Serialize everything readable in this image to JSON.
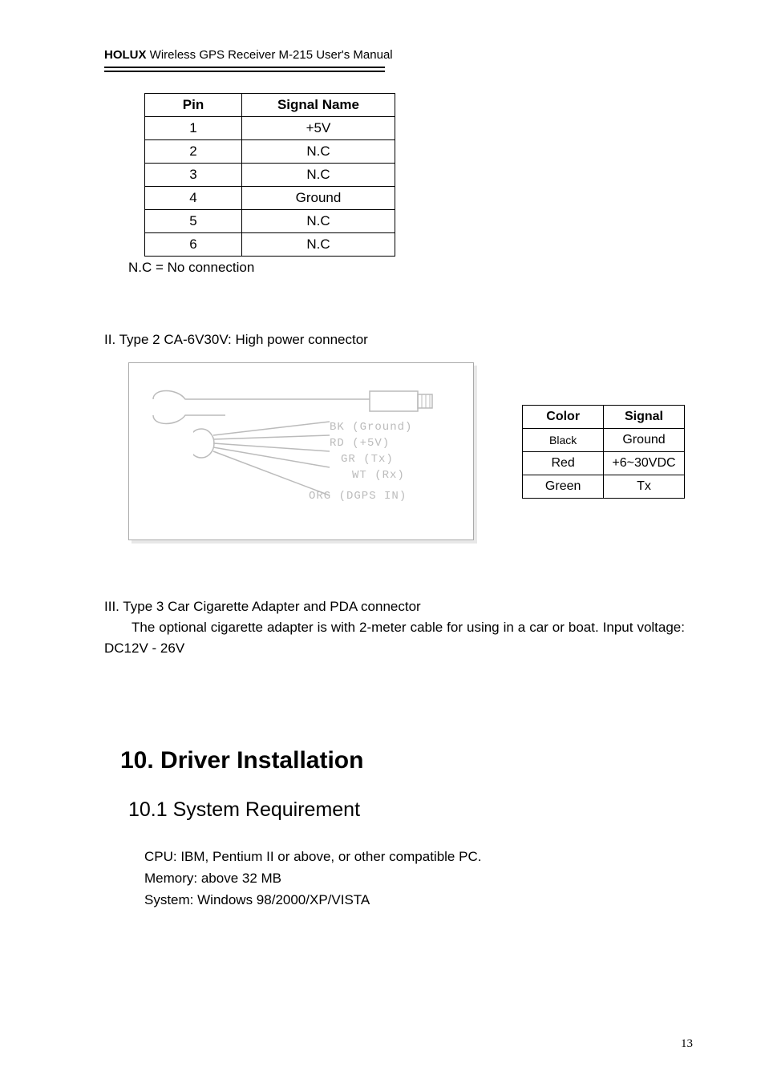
{
  "header": {
    "brand": "HOLUX",
    "rest": " Wireless GPS Receiver M-215 User's Manual"
  },
  "pinTable": {
    "headers": [
      "Pin",
      "Signal Name"
    ],
    "rows": [
      [
        "1",
        "+5V"
      ],
      [
        "2",
        "N.C"
      ],
      [
        "3",
        "N.C"
      ],
      [
        "4",
        "Ground"
      ],
      [
        "5",
        "N.C"
      ],
      [
        "6",
        "N.C"
      ]
    ]
  },
  "note": "N.C = No connection",
  "sectionII": "II. Type 2 CA-6V30V:   High power connector",
  "diagramLabels": {
    "l1": "BK (Ground)",
    "l2": "RD (+5V)",
    "l3": "GR (Tx)",
    "l4": "WT (Rx)",
    "l5": "ORG (DGPS IN)"
  },
  "colorTable": {
    "headers": [
      "Color",
      "Signal"
    ],
    "rows": [
      [
        "Black",
        "Ground"
      ],
      [
        "Red",
        "+6~30VDC"
      ],
      [
        "Green",
        "Tx"
      ]
    ]
  },
  "sectionIII": {
    "title": "III. Type 3 Car Cigarette Adapter and PDA connector",
    "body": "The optional cigarette adapter is with 2-meter cable for using in a car or boat. Input voltage: DC12V - 26V"
  },
  "driverTitle": "10. Driver Installation",
  "sysReq": {
    "title": "10.1 System Requirement",
    "cpu": "CPU: IBM, Pentium II or above, or other compatible PC.",
    "mem": "Memory: above 32 MB",
    "sys": "System: Windows 98/2000/XP/VISTA"
  },
  "pageNum": "13"
}
